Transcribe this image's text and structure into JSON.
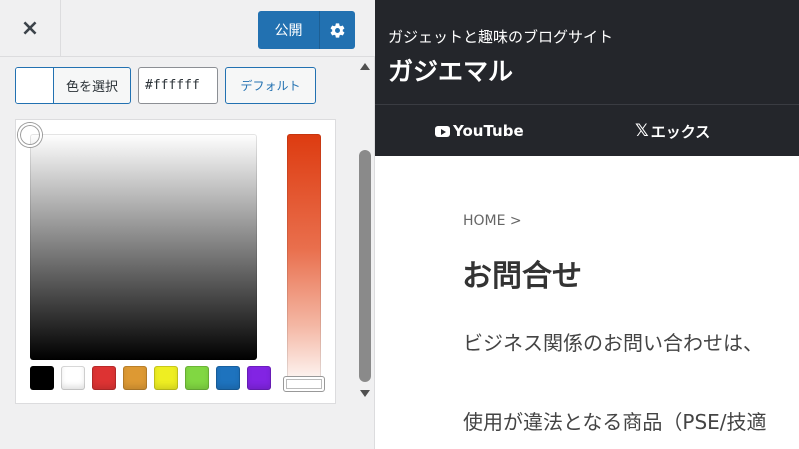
{
  "customizer": {
    "close_icon": "×",
    "publish_label": "公開",
    "gear_icon": "gear-icon",
    "color_select_label": "色を選択",
    "hex_value": "#ffffff",
    "default_label": "デフォルト",
    "current_color": "#ffffff",
    "palette": [
      "#000000",
      "#ffffff",
      "#dd3333",
      "#dd9933",
      "#eeee22",
      "#81d742",
      "#1e73be",
      "#8224e3"
    ]
  },
  "site": {
    "tagline": "ガジェットと趣味のブログサイト",
    "title": "ガジエマル",
    "nav": [
      {
        "label": "YouTube",
        "icon": "youtube-icon"
      },
      {
        "label": "エックス",
        "icon": "x-icon"
      }
    ],
    "x_glyph": "𝕏",
    "breadcrumb": "HOME >",
    "page_title": "お問合せ",
    "paragraphs": [
      "ビジネス関係のお問い合わせは、",
      "使用が違法となる商品（PSE/技適"
    ]
  },
  "colors": {
    "accent": "#2271b1",
    "header_bg": "#24262b",
    "panel_bg": "#f0f0f1"
  }
}
